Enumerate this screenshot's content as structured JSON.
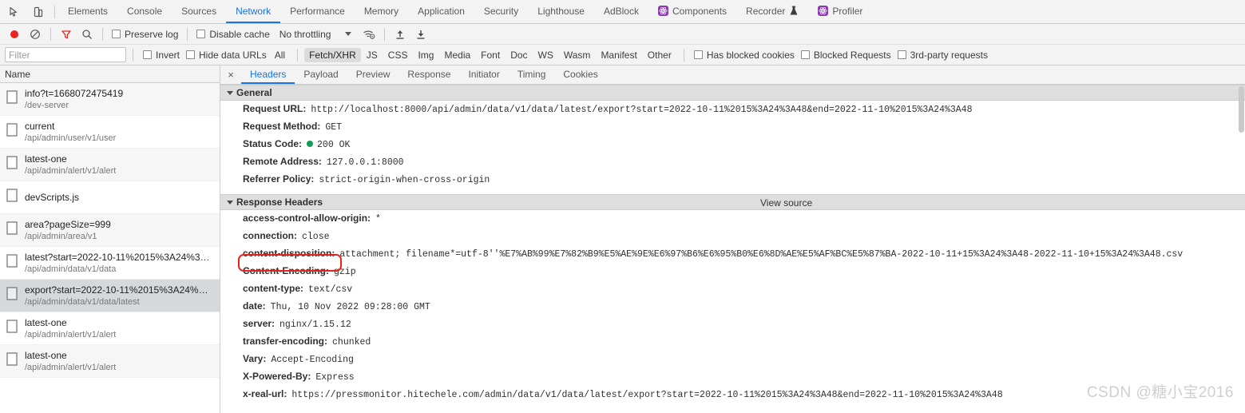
{
  "window": {
    "panel_icons": [
      {
        "name": "inspect-element-icon"
      },
      {
        "name": "device-toolbar-icon"
      }
    ]
  },
  "main_tabs": [
    {
      "label": "Elements",
      "active": false,
      "badge": null
    },
    {
      "label": "Console",
      "active": false,
      "badge": null
    },
    {
      "label": "Sources",
      "active": false,
      "badge": null
    },
    {
      "label": "Network",
      "active": true,
      "badge": null
    },
    {
      "label": "Performance",
      "active": false,
      "badge": null
    },
    {
      "label": "Memory",
      "active": false,
      "badge": null
    },
    {
      "label": "Application",
      "active": false,
      "badge": null
    },
    {
      "label": "Security",
      "active": false,
      "badge": null
    },
    {
      "label": "Lighthouse",
      "active": false,
      "badge": null
    },
    {
      "label": "AdBlock",
      "active": false,
      "badge": null
    },
    {
      "label": "Components",
      "active": false,
      "badge": "react-extension-icon"
    },
    {
      "label": "Recorder",
      "active": false,
      "badge": "flask-icon"
    },
    {
      "label": "Profiler",
      "active": false,
      "badge": "react-extension-icon"
    }
  ],
  "network_toolbar": {
    "record_button": "record-icon",
    "clear_button": "clear-icon",
    "filter_button": "filter-icon",
    "search_button": "search-icon",
    "preserve_log": {
      "label": "Preserve log",
      "checked": false
    },
    "disable_cache": {
      "label": "Disable cache",
      "checked": false
    },
    "throttling": {
      "value": "No throttling"
    },
    "network_conditions_button": "network-conditions-icon",
    "import_har_button": "upload-arrow-icon",
    "export_har_button": "download-arrow-icon"
  },
  "filter_bar": {
    "filter_placeholder": "Filter",
    "filter_value": "",
    "invert": {
      "label": "Invert",
      "checked": false
    },
    "hide_data_urls": {
      "label": "Hide data URLs",
      "checked": false
    },
    "types": [
      {
        "label": "All",
        "selected": false
      },
      {
        "label": "Fetch/XHR",
        "selected": true
      },
      {
        "label": "JS",
        "selected": false
      },
      {
        "label": "CSS",
        "selected": false
      },
      {
        "label": "Img",
        "selected": false
      },
      {
        "label": "Media",
        "selected": false
      },
      {
        "label": "Font",
        "selected": false
      },
      {
        "label": "Doc",
        "selected": false
      },
      {
        "label": "WS",
        "selected": false
      },
      {
        "label": "Wasm",
        "selected": false
      },
      {
        "label": "Manifest",
        "selected": false
      },
      {
        "label": "Other",
        "selected": false
      }
    ],
    "has_blocked_cookies": {
      "label": "Has blocked cookies",
      "checked": false
    },
    "blocked_requests": {
      "label": "Blocked Requests",
      "checked": false
    },
    "third_party_requests": {
      "label": "3rd-party requests",
      "checked": false
    }
  },
  "request_list": {
    "column_header": "Name",
    "rows": [
      {
        "name": "info?t=1668072475419",
        "path": "/dev-server",
        "selected": false
      },
      {
        "name": "current",
        "path": "/api/admin/user/v1/user",
        "selected": false
      },
      {
        "name": "latest-one",
        "path": "/api/admin/alert/v1/alert",
        "selected": false
      },
      {
        "name": "devScripts.js",
        "path": "",
        "selected": false
      },
      {
        "name": "area?pageSize=999",
        "path": "/api/admin/area/v1",
        "selected": false
      },
      {
        "name": "latest?start=2022-10-11%2015%3A24%3…",
        "path": "/api/admin/data/v1/data",
        "selected": false
      },
      {
        "name": "export?start=2022-10-11%2015%3A24%…",
        "path": "/api/admin/data/v1/data/latest",
        "selected": true
      },
      {
        "name": "latest-one",
        "path": "/api/admin/alert/v1/alert",
        "selected": false
      },
      {
        "name": "latest-one",
        "path": "/api/admin/alert/v1/alert",
        "selected": false
      }
    ]
  },
  "detail_tabs": {
    "close_label": "×",
    "tabs": [
      {
        "label": "Headers",
        "active": true
      },
      {
        "label": "Payload",
        "active": false
      },
      {
        "label": "Preview",
        "active": false
      },
      {
        "label": "Response",
        "active": false
      },
      {
        "label": "Initiator",
        "active": false
      },
      {
        "label": "Timing",
        "active": false
      },
      {
        "label": "Cookies",
        "active": false
      }
    ]
  },
  "headers": {
    "general": {
      "section_title": "General",
      "rows": [
        {
          "key": "Request URL:",
          "value": "http://localhost:8000/api/admin/data/v1/data/latest/export?start=2022-10-11%2015%3A24%3A48&end=2022-11-10%2015%3A24%3A48",
          "status": false
        },
        {
          "key": "Request Method:",
          "value": "GET",
          "status": false
        },
        {
          "key": "Status Code:",
          "value": "200 OK",
          "status": true
        },
        {
          "key": "Remote Address:",
          "value": "127.0.0.1:8000",
          "status": false
        },
        {
          "key": "Referrer Policy:",
          "value": "strict-origin-when-cross-origin",
          "status": false
        }
      ]
    },
    "response": {
      "section_title": "Response Headers",
      "view_source": "View source",
      "rows": [
        {
          "key": "access-control-allow-origin:",
          "value": "*"
        },
        {
          "key": "connection:",
          "value": "close"
        },
        {
          "key": "content-disposition:",
          "value": "attachment; filename*=utf-8''%E7%AB%99%E7%82%B9%E5%AE%9E%E6%97%B6%E6%95%B0%E6%8D%AE%E5%AF%BC%E5%87%BA-2022-10-11+15%3A24%3A48-2022-11-10+15%3A24%3A48.csv"
        },
        {
          "key": "Content-Encoding:",
          "value": "gzip"
        },
        {
          "key": "content-type:",
          "value": "text/csv"
        },
        {
          "key": "date:",
          "value": "Thu, 10 Nov 2022 09:28:00 GMT"
        },
        {
          "key": "server:",
          "value": "nginx/1.15.12"
        },
        {
          "key": "transfer-encoding:",
          "value": "chunked"
        },
        {
          "key": "Vary:",
          "value": "Accept-Encoding"
        },
        {
          "key": "X-Powered-By:",
          "value": "Express"
        },
        {
          "key": "x-real-url:",
          "value": "https://pressmonitor.hitechele.com/admin/data/v1/data/latest/export?start=2022-10-11%2015%3A24%3A48&end=2022-11-10%2015%3A24%3A48"
        }
      ]
    }
  },
  "annotation": {
    "name": "content-disposition-highlight",
    "color": "#e8241f"
  },
  "watermark": "CSDN @糖小宝2016"
}
